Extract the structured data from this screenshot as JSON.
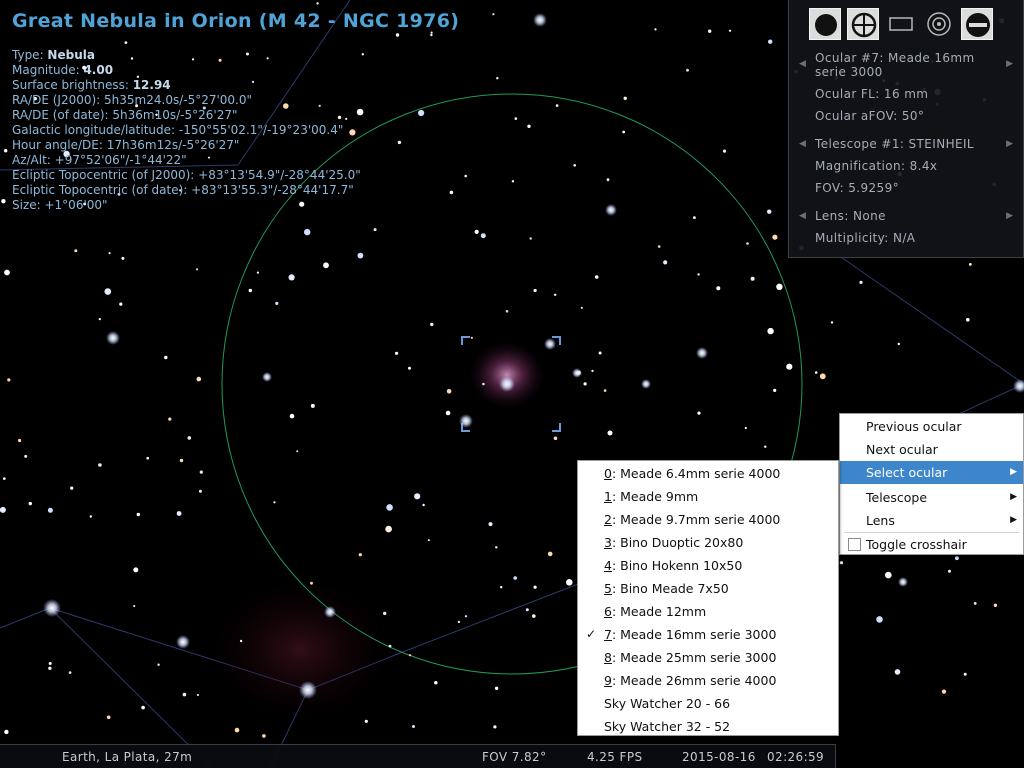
{
  "object": {
    "title": "Great Nebula in Orion (M 42 - NGC 1976)",
    "type_label": "Type: ",
    "type_value": "Nebula",
    "magnitude_label": "Magnitude: ",
    "magnitude_value": "4.00",
    "surface_label": "Surface brightness: ",
    "surface_value": "12.94",
    "lines": [
      "RA/DE (J2000): 5h35m24.0s/-5°27'00.0\"",
      "RA/DE (of date): 5h36m10s/-5°26'27\"",
      "Galactic longitude/latitude: -150°55'02.1\"/-19°23'00.4\"",
      "Hour angle/DE: 17h36m12s/-5°26'27\"",
      "Az/Alt: +97°52'06\"/-1°44'22\"",
      "Ecliptic Topocentric (of J2000): +83°13'54.9\"/-28°44'25.0\"",
      "Ecliptic Topocentric (of date): +83°13'55.3\"/-28°44'17.7\"",
      "Size: +1°06'00\""
    ]
  },
  "ocular_panel": {
    "toolbar": [
      "ocular-view-icon",
      "crosshair-icon",
      "ccd-frame-icon",
      "telrad-icon",
      "configure-icon"
    ],
    "ocular_line1": "Ocular #7: Meade 16mm",
    "ocular_line2": "serie 3000",
    "ocular_fl": "Ocular FL: 16 mm",
    "ocular_afov": "Ocular aFOV: 50°",
    "telescope": "Telescope #1: STEINHEIL",
    "magnification": "Magnification: 8.4x",
    "fov": "FOV: 5.9259°",
    "lens": "Lens: None",
    "multiplicity": "Multiplicity: N/A"
  },
  "context_menu": {
    "previous": "Previous ocular",
    "next": "Next ocular",
    "select": "Select ocular",
    "telescope": "Telescope",
    "lens": "Lens",
    "crosshair": "Toggle crosshair"
  },
  "ocular_submenu": [
    {
      "num": "0",
      "label": ": Meade 6.4mm serie 4000",
      "checked": false
    },
    {
      "num": "1",
      "label": ": Meade 9mm",
      "checked": false
    },
    {
      "num": "2",
      "label": ": Meade 9.7mm serie 4000",
      "checked": false
    },
    {
      "num": "3",
      "label": ": Bino Duoptic 20x80",
      "checked": false
    },
    {
      "num": "4",
      "label": ": Bino Hokenn 10x50",
      "checked": false
    },
    {
      "num": "5",
      "label": ": Bino Meade 7x50",
      "checked": false
    },
    {
      "num": "6",
      "label": ": Meade 12mm",
      "checked": false
    },
    {
      "num": "7",
      "label": ": Meade 16mm serie 3000",
      "checked": true
    },
    {
      "num": "8",
      "label": ": Meade 25mm serie 3000",
      "checked": false
    },
    {
      "num": "9",
      "label": ": Meade 26mm serie 4000",
      "checked": false
    },
    {
      "num": "",
      "label": "Sky Watcher 20 - 66",
      "checked": false
    },
    {
      "num": "",
      "label": "Sky Watcher 32 - 52",
      "checked": false
    }
  ],
  "status": {
    "location": "Earth, La Plata, 27m",
    "fov": "FOV 7.82°",
    "fps": "4.25 FPS",
    "date": "2015-08-16",
    "time": "02:26:59"
  },
  "colors": {
    "title": "#4fa3d6",
    "menu_highlight": "#3d86cc",
    "ocular_circle": "#1f9a5a",
    "constellation_lines": "#3a4a8c"
  }
}
